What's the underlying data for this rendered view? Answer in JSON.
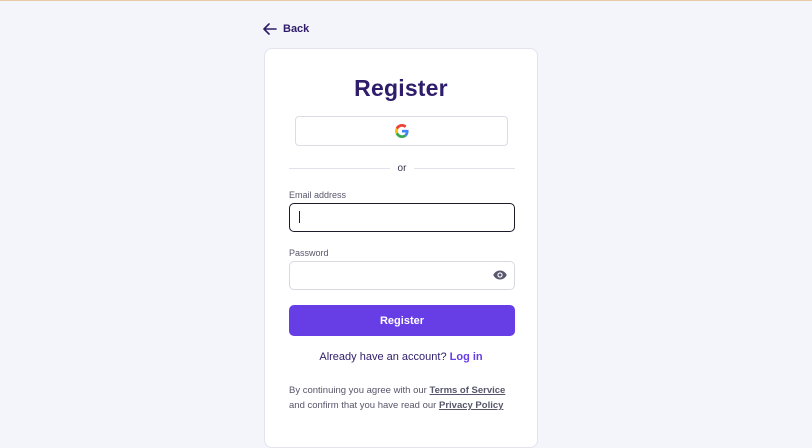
{
  "nav": {
    "back_label": "Back"
  },
  "card": {
    "title": "Register",
    "google_button": {
      "icon": "google-icon"
    },
    "divider_text": "or",
    "email": {
      "label": "Email address",
      "value": "",
      "placeholder": ""
    },
    "password": {
      "label": "Password",
      "value": "",
      "placeholder": "",
      "toggle_icon": "eye-icon"
    },
    "submit_label": "Register",
    "login_prompt": "Already have an account?",
    "login_link": "Log in",
    "legal": {
      "prefix": "By continuing you agree with our",
      "terms_link": "Terms of Service",
      "middle": "and confirm that you have read our",
      "privacy_link": "Privacy Policy"
    }
  },
  "colors": {
    "brand": "#673de6",
    "heading": "#2f1c6a",
    "background": "#f4f4fb"
  }
}
